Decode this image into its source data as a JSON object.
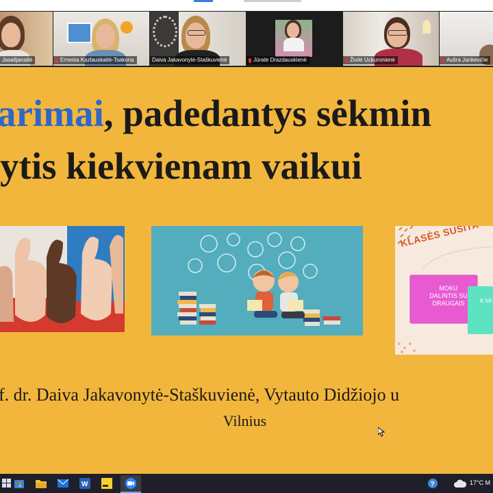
{
  "participants": [
    {
      "name": "Jasašjanaitė"
    },
    {
      "name": "Ernesta Kazlauskaitė-Tsakona"
    },
    {
      "name": "Daiva Jakavonytė-Staškuvienė"
    },
    {
      "name": "Jūratė Drazdauskienė"
    },
    {
      "name": "Živilė Uckuronienė"
    },
    {
      "name": "Aušra Jankevičie"
    }
  ],
  "slide": {
    "title_line1_accent": "arimai",
    "title_line1_rest": ", padedantys sėkmin",
    "title_line2": "ytis kiekvienam vaikui",
    "author": "f. dr. Daiva Jakavonytė-Staškuvienė, Vytauto Didžiojo u",
    "city": "Vilnius",
    "poster": {
      "heading": "KLASĖS SUSITA",
      "card_text": "MOKU DALINTIS SU DRAUGAIS",
      "card2_text": "K VA"
    }
  },
  "taskbar": {
    "temperature": "17°C",
    "tray_cut": "M"
  },
  "colors": {
    "slide_bg": "#f2b63c",
    "accent_blue": "#2f67c8",
    "taskbar_bg": "#1f1f2a"
  }
}
